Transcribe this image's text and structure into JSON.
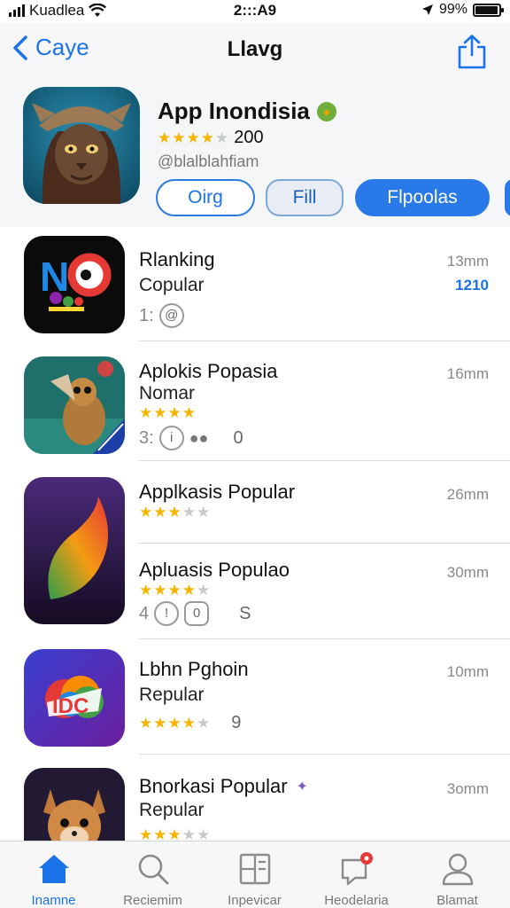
{
  "status": {
    "carrier": "Kuadlea",
    "time": "2:::A9",
    "battery": "99%"
  },
  "nav": {
    "back_label": "Caye",
    "title": "Llavg"
  },
  "featured": {
    "title": "App Inondisia",
    "rating_text": "200",
    "stars": 4,
    "subtitle": "@blalblahfiam",
    "chips": [
      "Oirg",
      "Fill",
      "Flpoolas"
    ]
  },
  "list": [
    {
      "title": "Rlanking",
      "subtitle": "Copular",
      "time": "13mm",
      "badge": "1210",
      "meta": "1:",
      "meta_icon": "@"
    },
    {
      "title": "Aplokis Popasia",
      "subtitle": "Nomar",
      "time": "16mm",
      "stars": 4,
      "meta": "3:",
      "meta_extra": "0"
    },
    {
      "title": "Applkasis Popular",
      "time": "26mm",
      "stars": 3
    },
    {
      "title": "Apluasis Populao",
      "time": "30mm",
      "stars": 4,
      "meta": "4",
      "meta_extra": "S"
    },
    {
      "title": "Lbhn Pghoin",
      "subtitle": "Repular",
      "time": "10mm",
      "stars": 4,
      "meta_extra": "9"
    },
    {
      "title": "Bnorkasi Popular",
      "subtitle": "Repular",
      "time": "3omm",
      "stars": 3
    }
  ],
  "tabs": [
    {
      "label": "Inamne",
      "icon": "home-icon",
      "active": true
    },
    {
      "label": "Reciemim",
      "icon": "search-icon"
    },
    {
      "label": "Inpevicar",
      "icon": "apps-icon"
    },
    {
      "label": "Heodelaria",
      "icon": "updates-icon"
    },
    {
      "label": "Blamat",
      "icon": "account-icon"
    }
  ],
  "colors": {
    "accent": "#1a73e8",
    "star": "#f4b400"
  }
}
